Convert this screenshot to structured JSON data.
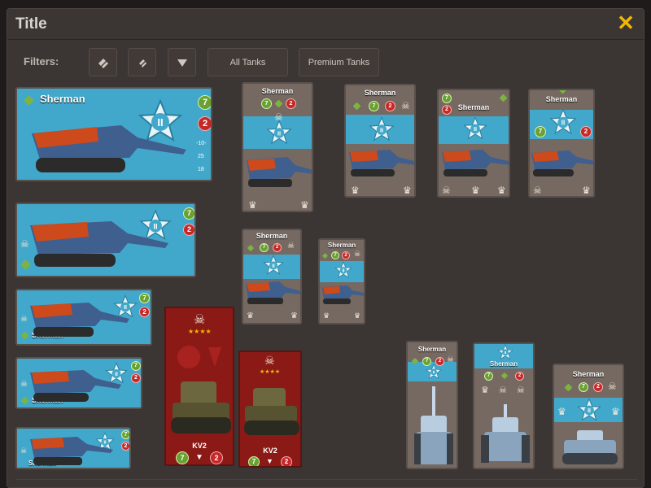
{
  "window": {
    "title": "Title"
  },
  "filters": {
    "label": "Filters:",
    "all_tanks": "All Tanks",
    "premium_tanks": "Premium Tanks"
  },
  "cards": {
    "tank_name": "Sherman",
    "kv_name": "KV2",
    "tier": "II",
    "green_value": "7",
    "red_value": "2",
    "stat_a": "-10-",
    "stat_b": "25",
    "stat_c": "18"
  },
  "icons": [
    "close-icon",
    "filter-icon-1",
    "filter-icon-2",
    "filter-icon-3",
    "tier-star-icon",
    "skull-icon",
    "leaf-icon"
  ],
  "colors": {
    "accent": "#f2b705",
    "band": "#42a8cb",
    "green": "#6aa232",
    "red": "#c62828",
    "premium": "#8b1a17"
  }
}
